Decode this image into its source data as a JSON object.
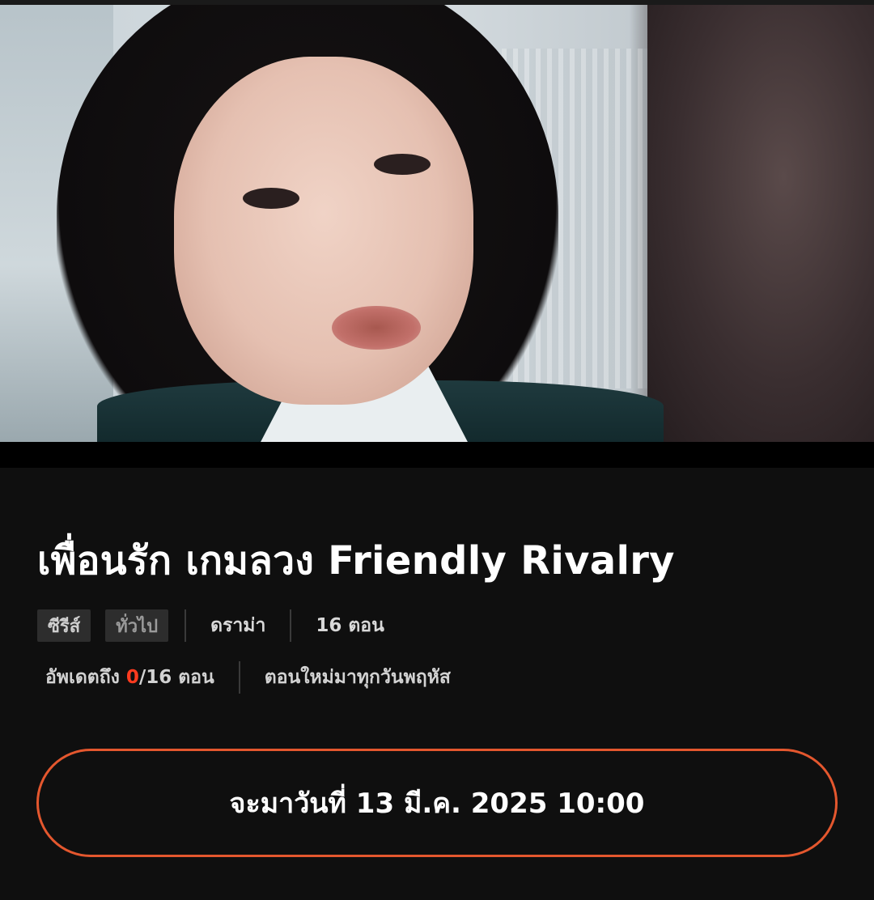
{
  "hero": {
    "image_name": "series-still-image"
  },
  "show": {
    "title": "เพื่อนรัก เกมลวง Friendly Rivalry",
    "tags": [
      "ซีรีส์",
      "ทั่วไป"
    ],
    "genre": "ดราม่า",
    "episode_count": "16 ตอน"
  },
  "update": {
    "label": "อัพเดตถึง ",
    "current": "0",
    "total": "/16 ตอน",
    "schedule": "ตอนใหม่มาทุกวันพฤหัส"
  },
  "cta": {
    "label": "จะมาวันที่ 13 มี.ค. 2025 10:00"
  },
  "colors": {
    "accent": "#e4572e",
    "highlight": "#ff3b1f",
    "background": "#0f0f0f",
    "chip": "#2d2d2d"
  }
}
